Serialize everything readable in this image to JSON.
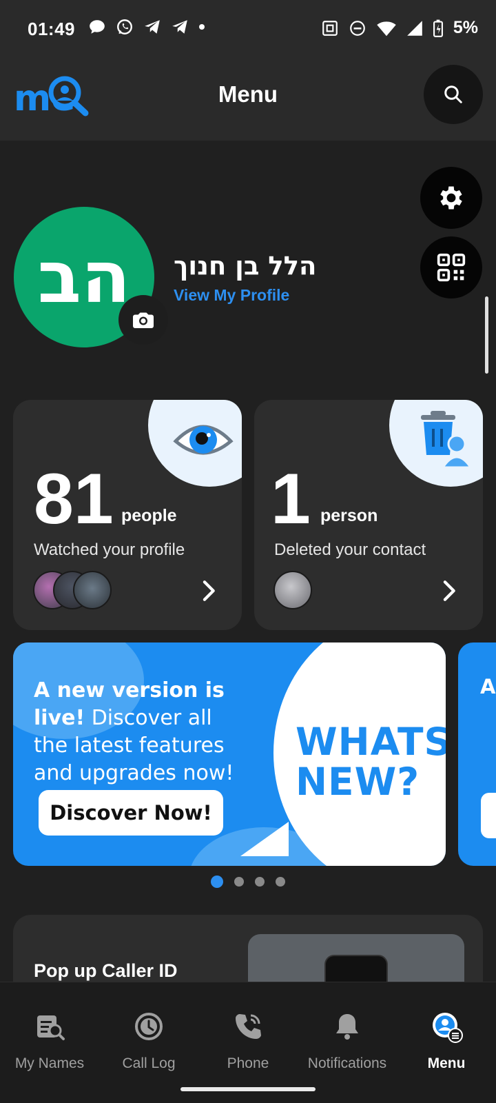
{
  "status_bar": {
    "time": "01:49",
    "battery": "5%",
    "icons_left": [
      "chat-bubble-icon",
      "whatsapp-icon",
      "telegram-icon",
      "telegram-icon",
      "dot-icon"
    ],
    "icons_right": [
      "nfc-icon",
      "do-not-disturb-icon",
      "wifi-icon",
      "signal-icon",
      "battery-charging-icon"
    ]
  },
  "header": {
    "title": "Menu",
    "logo_text": "me"
  },
  "profile": {
    "initials": "הב",
    "name": "הלל בן חנוך",
    "link": "View My Profile",
    "avatar_color": "#0aa56c"
  },
  "stats": [
    {
      "number": "81",
      "unit": "people",
      "caption": "Watched your profile",
      "icon": "eye-icon"
    },
    {
      "number": "1",
      "unit": "person",
      "caption": "Deleted your contact",
      "icon": "trash-person-icon"
    }
  ],
  "banner": {
    "bold_text": "A new version is live!",
    "text": " Discover all the latest features and upgrades now!",
    "cta": "Discover Now!",
    "headline_line1": "WHATS",
    "headline_line2": "NEW?",
    "next_peek": "Al up fe ap Te"
  },
  "carousel": {
    "count": 4,
    "active": 0
  },
  "popup_card": {
    "label": "Pop up Caller ID"
  },
  "nav": [
    {
      "label": "My Names",
      "icon": "my-names-icon",
      "active": false
    },
    {
      "label": "Call Log",
      "icon": "call-log-icon",
      "active": false
    },
    {
      "label": "Phone",
      "icon": "phone-icon",
      "active": false
    },
    {
      "label": "Notifications",
      "icon": "bell-icon",
      "active": false
    },
    {
      "label": "Menu",
      "icon": "menu-icon",
      "active": true
    }
  ],
  "colors": {
    "accent": "#2d8ff0",
    "background": "#202020",
    "card": "#2d2d2d",
    "banner": "#1c8cf0"
  }
}
